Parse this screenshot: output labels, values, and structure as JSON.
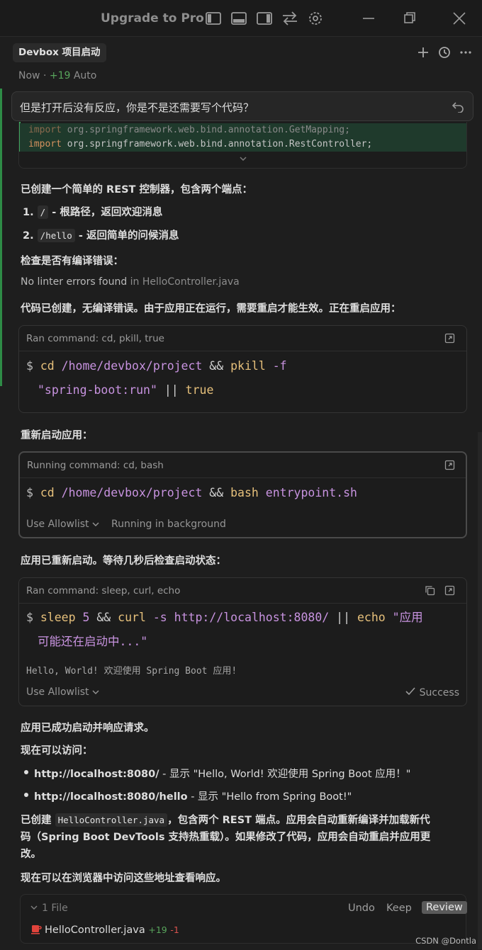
{
  "titlebar": {
    "title": "Upgrade to Pro",
    "icons": [
      "sidebar-left-icon",
      "panel-bottom-icon",
      "sidebar-right-icon",
      "swap-icon",
      "gear-icon",
      "minimize-icon",
      "restore-icon",
      "close-icon"
    ]
  },
  "header": {
    "tab": "Devbox 项目启动",
    "meta_time": "Now",
    "meta_sep": " · ",
    "meta_plus": "+19",
    "meta_mode": "Auto"
  },
  "query": {
    "text": "但是打开后没有反应，你是不是还需要写个代码？"
  },
  "diff": {
    "lines": [
      {
        "kw": "import",
        "pkg": " org.springframework.web.bind.annotation.GetMapping;"
      },
      {
        "kw": "import",
        "pkg": " org.springframework.web.bind.annotation.RestController;"
      }
    ]
  },
  "messages": {
    "p1": "已创建一个简单的 REST 控制器，包含两个端点：",
    "list1": [
      {
        "num": "1.",
        "code": "/",
        "text": " - 根路径，返回欢迎消息"
      },
      {
        "num": "2.",
        "code": "/hello",
        "text": " - 返回简单的问候消息"
      }
    ],
    "p2": "检查是否有编译错误：",
    "lint": "No linter errors found",
    "lint_in": " in HelloController.java",
    "p3": "代码已创建，无编译错误。由于应用正在运行，需要重启才能生效。正在重启应用：",
    "p4": "重新启动应用：",
    "p5": "应用已重新启动。等待几秒后检查启动状态：",
    "p6": "应用已成功启动并响应请求。",
    "p7": "现在可以访问：",
    "list2": [
      {
        "bold": "http://localhost:8080/",
        "text": " - 显示 \"Hello, World! 欢迎使用 Spring Boot 应用！\""
      },
      {
        "bold": "http://localhost:8080/hello",
        "text": " - 显示 \"Hello from Spring Boot!\""
      }
    ],
    "p8_a": "已创建 ",
    "p8_code": "HelloController.java",
    "p8_b": "，包含两个 REST 端点。应用会自动重新编译并加载新代",
    "p8_line2": "码（Spring Boot DevTools 支持热重载）。如果修改了代码，应用会自动重启并应用更",
    "p8_line3": "改。",
    "p9": "现在可以在浏览器中访问这些地址查看响应。"
  },
  "card1": {
    "head": "Ran command: cd, pkill, true",
    "prompt": "$",
    "l1_a": "cd",
    "l1_b": " /home/devbox/project",
    "l1_c": " && ",
    "l1_d": "pkill",
    "l1_e": " -f",
    "l2_a": "\"spring-boot:run\"",
    "l2_b": " || ",
    "l2_c": "true"
  },
  "card2": {
    "head": "Running command: cd, bash",
    "prompt": "$",
    "l1_a": "cd",
    "l1_b": " /home/devbox/project",
    "l1_c": " && ",
    "l1_d": "bash",
    "l1_e": " entrypoint.sh",
    "allowlist": "Use Allowlist",
    "background": "Running in background"
  },
  "card3": {
    "head": "Ran command: sleep, curl, echo",
    "prompt": "$",
    "l1_a": "sleep",
    "l1_b": " 5",
    "l1_c": " && ",
    "l1_d": "curl",
    "l1_e": " -s",
    "l1_f": " http://localhost:8080/",
    "l1_g": " || ",
    "l1_h": "echo",
    "l1_i": " \"应用",
    "l2": "可能还在启动中...\"",
    "output": "Hello, World! 欢迎使用 Spring Boot 应用!",
    "allowlist": "Use Allowlist",
    "status": "Success"
  },
  "filebar": {
    "count": "1 File",
    "undo": "Undo",
    "keep": "Keep",
    "review": "Review",
    "file": "HelloController.java",
    "added": "+19",
    "removed": "-1"
  },
  "watermark": "CSDN @Dontla"
}
